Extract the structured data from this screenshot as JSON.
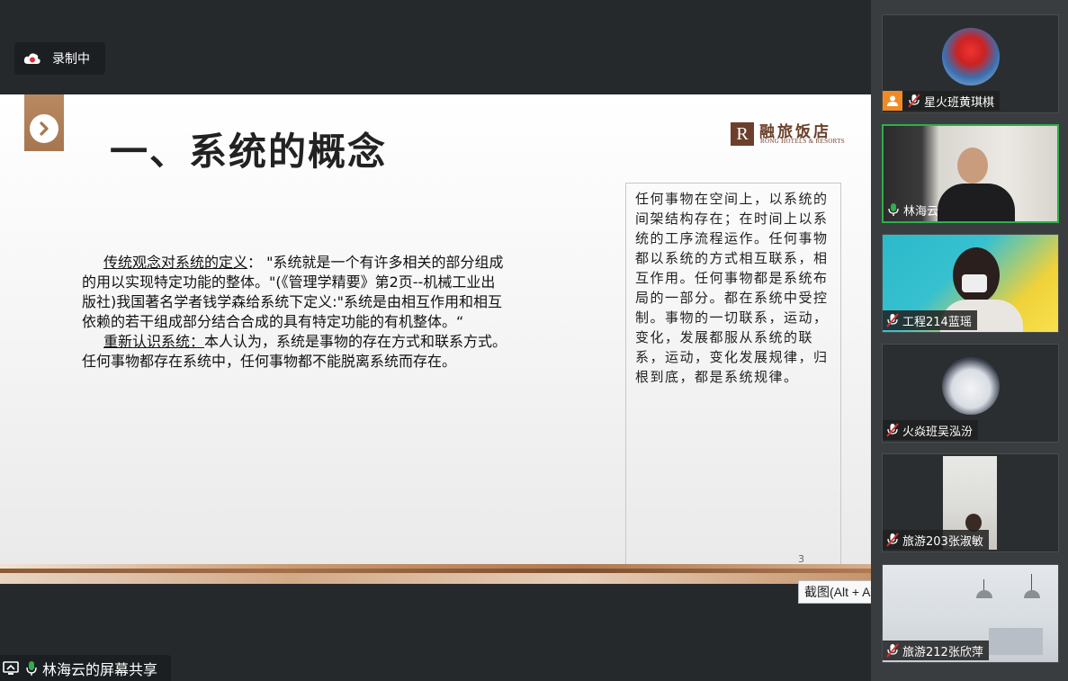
{
  "recording": {
    "label": "录制中"
  },
  "slide": {
    "title": "一、系统的概念",
    "logo": {
      "mark": "R",
      "cn": "融旅饭店",
      "en": "RONG HOTELS & RESORTS"
    },
    "para1_lead": "传统观念对系统的定义",
    "para1_rest": "：  \"系统就是一个有许多相关的部分组成的用以实现特定功能的整体。\"(《管理学精要》第2页--机械工业出版社)我国著名学者钱学森给系统下定义:\"系统是由相互作用和相互依赖的若干组成部分结合合成的具有特定功能的有机整体。“",
    "para2_lead": "重新认识系统：",
    "para2_rest": "本人认为，系统是事物的存在方式和联系方式。任何事物都存在系统中，任何事物都不能脱离系统而存在。",
    "side_text": "任何事物在空间上，以系统的间架结构存在；在时间上以系统的工序流程运作。任何事物都以系统的方式相互联系，相互作用。任何事物都是系统布局的一部分。都在系统中受控制。事物的一切联系，运动，变化，发展都服从系统的联系，运动，变化发展规律，归根到底，都是系统规律。",
    "page_number": "3"
  },
  "tooltip": {
    "text": "截图(Alt + A)"
  },
  "share_bar": {
    "label": "林海云的屏幕共享"
  },
  "participants": [
    {
      "name": "星火班黄琪棋"
    },
    {
      "name": "林海云"
    },
    {
      "name": "工程214蓝瑶"
    },
    {
      "name": "火焱班吴泓汾"
    },
    {
      "name": "旅游203张淑敏"
    },
    {
      "name": "旅游212张欣萍"
    }
  ],
  "colors": {
    "accent_green": "#2fae4a",
    "brand_brown": "#6b3f2a",
    "record_red": "#e03030"
  }
}
